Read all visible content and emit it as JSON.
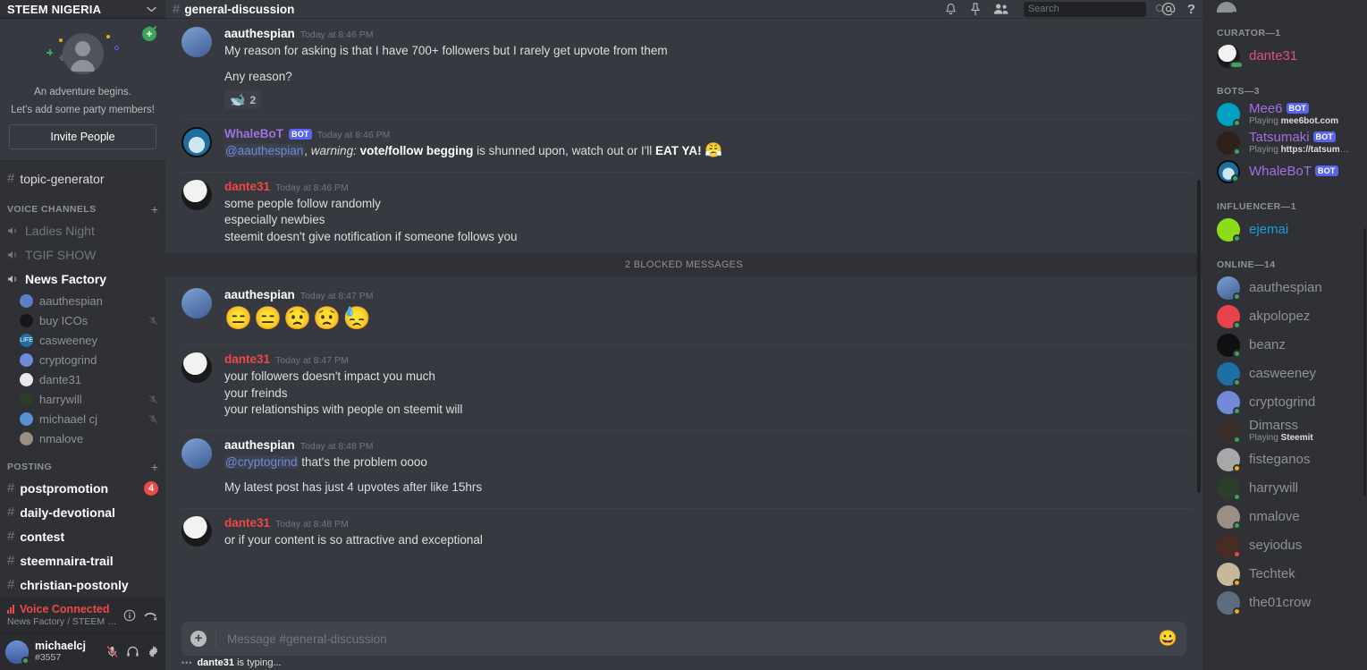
{
  "sidebar": {
    "server_name": "STEEM NIGERIA",
    "invite_card": {
      "line1": "An adventure begins.",
      "line2": "Let's add some party members!",
      "button": "Invite People",
      "close_icon": "close-icon"
    },
    "top_channels": [
      {
        "name": "topic-generator",
        "type": "text",
        "state": "muted"
      }
    ],
    "voice_category": {
      "label": "VOICE CHANNELS",
      "add_icon": "plus-icon"
    },
    "voice_channels": [
      {
        "name": "Ladies Night",
        "state": "muted"
      },
      {
        "name": "TGIF SHOW",
        "state": "muted"
      },
      {
        "name": "News Factory",
        "state": "active"
      }
    ],
    "voice_members": [
      {
        "name": "aauthespian",
        "muted": false,
        "color": "#5a7fc4"
      },
      {
        "name": "buy ICOs",
        "muted": true,
        "color": "#1a1a1a"
      },
      {
        "name": "casweeney",
        "muted": false,
        "color": "#1d6fa5"
      },
      {
        "name": "cryptogrind",
        "muted": false,
        "color": "#7289da"
      },
      {
        "name": "dante31",
        "muted": false,
        "color": "#e3e3e3"
      },
      {
        "name": "harrywill",
        "muted": true,
        "color": "#2c3e2a"
      },
      {
        "name": "michaael cj",
        "muted": true,
        "color": "#5b8fd4"
      },
      {
        "name": "nmalove",
        "muted": false,
        "color": "#9b8e82"
      }
    ],
    "posting_category": {
      "label": "POSTING",
      "add_icon": "plus-icon"
    },
    "posting_channels": [
      {
        "name": "postpromotion",
        "badge": "4"
      },
      {
        "name": "daily-devotional",
        "badge": ""
      },
      {
        "name": "contest",
        "badge": ""
      },
      {
        "name": "steemnaira-trail",
        "badge": ""
      },
      {
        "name": "christian-postonly",
        "badge": ""
      }
    ],
    "voice_connected": {
      "title": "Voice Connected",
      "subtitle": "News Factory / STEEM NIGERIA",
      "info_icon": "info-icon",
      "disconnect_icon": "disconnect-call-icon"
    },
    "user_panel": {
      "username": "michaelcj",
      "discriminator": "#3557",
      "mic_icon": "mic-muted-icon",
      "headset_icon": "headphones-icon",
      "settings_icon": "gear-icon"
    }
  },
  "topbar": {
    "hash": "#",
    "channel": "general-discussion",
    "bell_icon": "bell-icon",
    "pin_icon": "pin-icon",
    "members_icon": "members-icon",
    "search_placeholder": "Search",
    "search_value": "",
    "search_icon": "search-icon",
    "mentions_icon": "at-icon",
    "help_icon": "help-icon"
  },
  "messages": [
    {
      "author": "aauthespian",
      "author_color": "white",
      "bot": false,
      "time": "Today at 8:46 PM",
      "lines": [
        {
          "text": "My reason for asking is that I have 700+ followers but I rarely get upvote from them",
          "gap": false
        },
        {
          "text": "Any reason?",
          "gap": true
        }
      ],
      "reaction": {
        "emoji": "🐋",
        "count": "2"
      },
      "separator": false
    },
    {
      "author": "WhaleBoT",
      "author_color": "purple",
      "bot": true,
      "bot_label": "BOT",
      "time": "Today at 8:46 PM",
      "rich_line": {
        "mention": "@aauthespian",
        "after_mention": ", ",
        "italic": "warning:",
        "space1": " ",
        "bold1": "vote/follow begging",
        "mid": " is shunned upon, watch out or I'll ",
        "bold2": "EAT YA!",
        "emoji": "😤"
      },
      "separator": true
    },
    {
      "author": "dante31",
      "author_color": "red",
      "bot": false,
      "time": "Today at 8:46 PM",
      "lines": [
        {
          "text": "some people follow randomly",
          "gap": false
        },
        {
          "text": "especially newbies",
          "gap": false
        },
        {
          "text": "steemit doesn't give notification if someone follows you",
          "gap": false
        }
      ],
      "separator": true
    },
    {
      "blocked_bar": "2 BLOCKED MESSAGES"
    },
    {
      "author": "aauthespian",
      "author_color": "white",
      "bot": false,
      "time": "Today at 8:47 PM",
      "emoji_line": "😑😑😟😟😓",
      "separator": false
    },
    {
      "author": "dante31",
      "author_color": "red",
      "bot": false,
      "time": "Today at 8:47 PM",
      "lines": [
        {
          "text": "your followers doesn't impact you much",
          "gap": false
        },
        {
          "text": "your freinds",
          "gap": false
        },
        {
          "text": "your relationships with people on steemit will",
          "gap": false
        }
      ],
      "separator": true
    },
    {
      "author": "aauthespian",
      "author_color": "white",
      "bot": false,
      "time": "Today at 8:48 PM",
      "mention_line": {
        "mention": "@cryptogrind",
        "rest": " that's the problem oooo"
      },
      "lines": [
        {
          "text": "My latest post has just 4 upvotes after like 15hrs",
          "gap": true
        }
      ],
      "separator": true
    },
    {
      "author": "dante31",
      "author_color": "red",
      "bot": false,
      "time": "Today at 8:48 PM",
      "lines": [
        {
          "text": "or if your content is so attractive and exceptional",
          "gap": false
        }
      ],
      "separator": true
    }
  ],
  "composer": {
    "plus_icon": "add-attachment-icon",
    "placeholder": "Message #general-discussion",
    "value": "",
    "emoji_icon": "emoji-picker-icon"
  },
  "typing": {
    "dots": "•••",
    "user": "dante31",
    "text": " is typing..."
  },
  "members_panel": {
    "groups": [
      {
        "label": "CURATOR—1",
        "members": [
          {
            "name": "dante31",
            "color": "pink",
            "status": "stream",
            "sub": "",
            "avatar": "#ececec",
            "big": true
          }
        ]
      },
      {
        "label": "BOTS—3",
        "members": [
          {
            "name": "Mee6",
            "color": "purple",
            "status": "online",
            "sub": "Playing mee6bot.com",
            "sub_bold": "mee6bot.com",
            "sub_pre": "Playing ",
            "bot": true,
            "bot_label": "BOT",
            "avatar": "#00a0c6",
            "big": true
          },
          {
            "name": "Tatsumaki",
            "color": "purple",
            "status": "online",
            "sub": "Playing https://tatsumaki.x...",
            "sub_bold": "https://tatsumaki.x…",
            "sub_pre": "Playing ",
            "bot": true,
            "bot_label": "BOT",
            "avatar": "#2d2119",
            "big": true
          },
          {
            "name": "WhaleBoT",
            "color": "purple",
            "status": "online",
            "sub": "",
            "bot": true,
            "bot_label": "BOT",
            "avatar": "#1c6ea4",
            "big": true
          }
        ]
      },
      {
        "label": "INFLUENCER—1",
        "members": [
          {
            "name": "ejemai",
            "color": "blue",
            "status": "online",
            "sub": "",
            "avatar": "#8ddc1a",
            "big": true
          }
        ]
      },
      {
        "label": "ONLINE—14",
        "members": [
          {
            "name": "aauthespian",
            "color": "white",
            "status": "online",
            "sub": "",
            "avatar": "#5a7fc4"
          },
          {
            "name": "akpolopez",
            "color": "white",
            "status": "online",
            "sub": "",
            "avatar": "#e8434c"
          },
          {
            "name": "beanz",
            "color": "white",
            "status": "online",
            "sub": "",
            "avatar": "#101010"
          },
          {
            "name": "casweeney",
            "color": "white",
            "status": "online",
            "sub": "",
            "avatar": "#1d6fa5"
          },
          {
            "name": "cryptogrind",
            "color": "white",
            "status": "online",
            "sub": "",
            "avatar": "#7289da"
          },
          {
            "name": "Dimarss",
            "color": "white",
            "status": "online",
            "sub": "Playing Steemit",
            "sub_bold": "Steemit",
            "sub_pre": "Playing ",
            "avatar": "#3b2e2a"
          },
          {
            "name": "fisteganos",
            "color": "white",
            "status": "idle",
            "sub": "",
            "avatar": "#a8a8a8"
          },
          {
            "name": "harrywill",
            "color": "white",
            "status": "online",
            "sub": "",
            "avatar": "#2c3e2a"
          },
          {
            "name": "nmalove",
            "color": "white",
            "status": "online",
            "sub": "",
            "avatar": "#9b8e82"
          },
          {
            "name": "seyiodus",
            "color": "white",
            "status": "dnd",
            "sub": "",
            "avatar": "#4a2b22"
          },
          {
            "name": "Techtek",
            "color": "white",
            "status": "idle",
            "sub": "",
            "avatar": "#c9b79a"
          },
          {
            "name": "the01crow",
            "color": "white",
            "status": "idle",
            "sub": "",
            "avatar": "#5d6d7e"
          }
        ]
      }
    ]
  }
}
